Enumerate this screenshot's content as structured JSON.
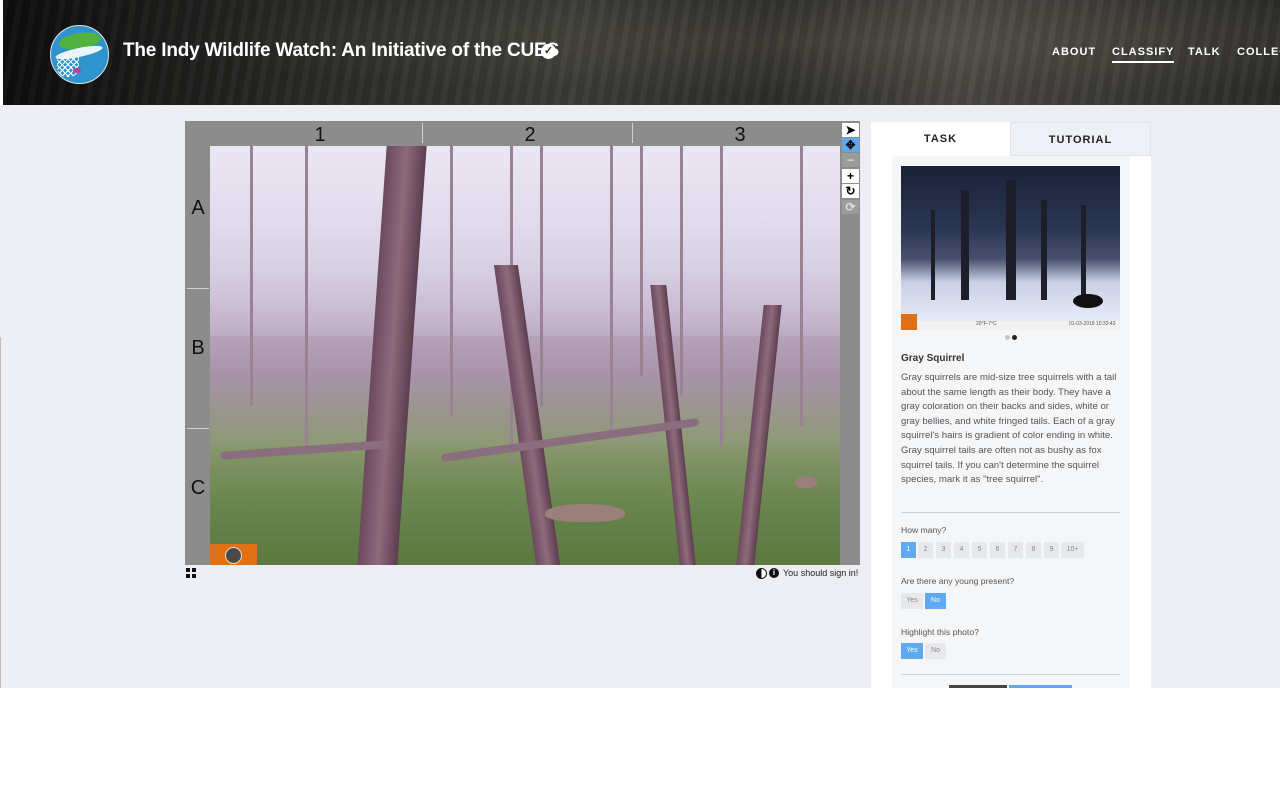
{
  "header": {
    "title": "The Indy Wildlife Watch: An Initiative of the CUES",
    "nav": [
      "ABOUT",
      "CLASSIFY",
      "TALK",
      "COLLEC"
    ],
    "active_nav": "CLASSIFY"
  },
  "viewer": {
    "columns": [
      "1",
      "2",
      "3"
    ],
    "rows": [
      "A",
      "B",
      "C"
    ],
    "tools": [
      "pointer-icon",
      "pan-icon",
      "zoom-out-icon",
      "zoom-in-icon",
      "rotate-icon",
      "reset-icon"
    ],
    "signin_text": "You should sign in!"
  },
  "panel": {
    "tabs": [
      "TASK",
      "TUTORIAL"
    ],
    "example_caption_mid": "20°F-7°C",
    "example_caption_right": "01-03-2018 10:33:43",
    "species_name": "Gray Squirrel",
    "species_description": "Gray squirrels are mid-size tree squirrels with a tail about the same length as their body. They have a gray coloration on their backs and sides, white or gray bellies, and white fringed tails. Each of a gray squirrel's hairs is gradient of color ending in white. Gray squirrel tails are often not as bushy as fox squirrel tails. If you can't determine the squirrel species, mark it as \"tree squirrel\".",
    "questions": {
      "how_many": {
        "label": "How many?",
        "options": [
          "1",
          "2",
          "3",
          "4",
          "5",
          "6",
          "7",
          "8",
          "9",
          "10+"
        ],
        "selected": "1"
      },
      "young": {
        "label": "Are there any young present?",
        "options": [
          "Yes",
          "No"
        ],
        "selected": "No"
      },
      "highlight": {
        "label": "Highlight this photo?",
        "options": [
          "Yes",
          "No"
        ],
        "selected": "Yes"
      }
    }
  },
  "colors": {
    "accent_blue": "#5fa9f0",
    "camera_badge_orange": "#e07014",
    "backdrop": "#eceef3"
  }
}
